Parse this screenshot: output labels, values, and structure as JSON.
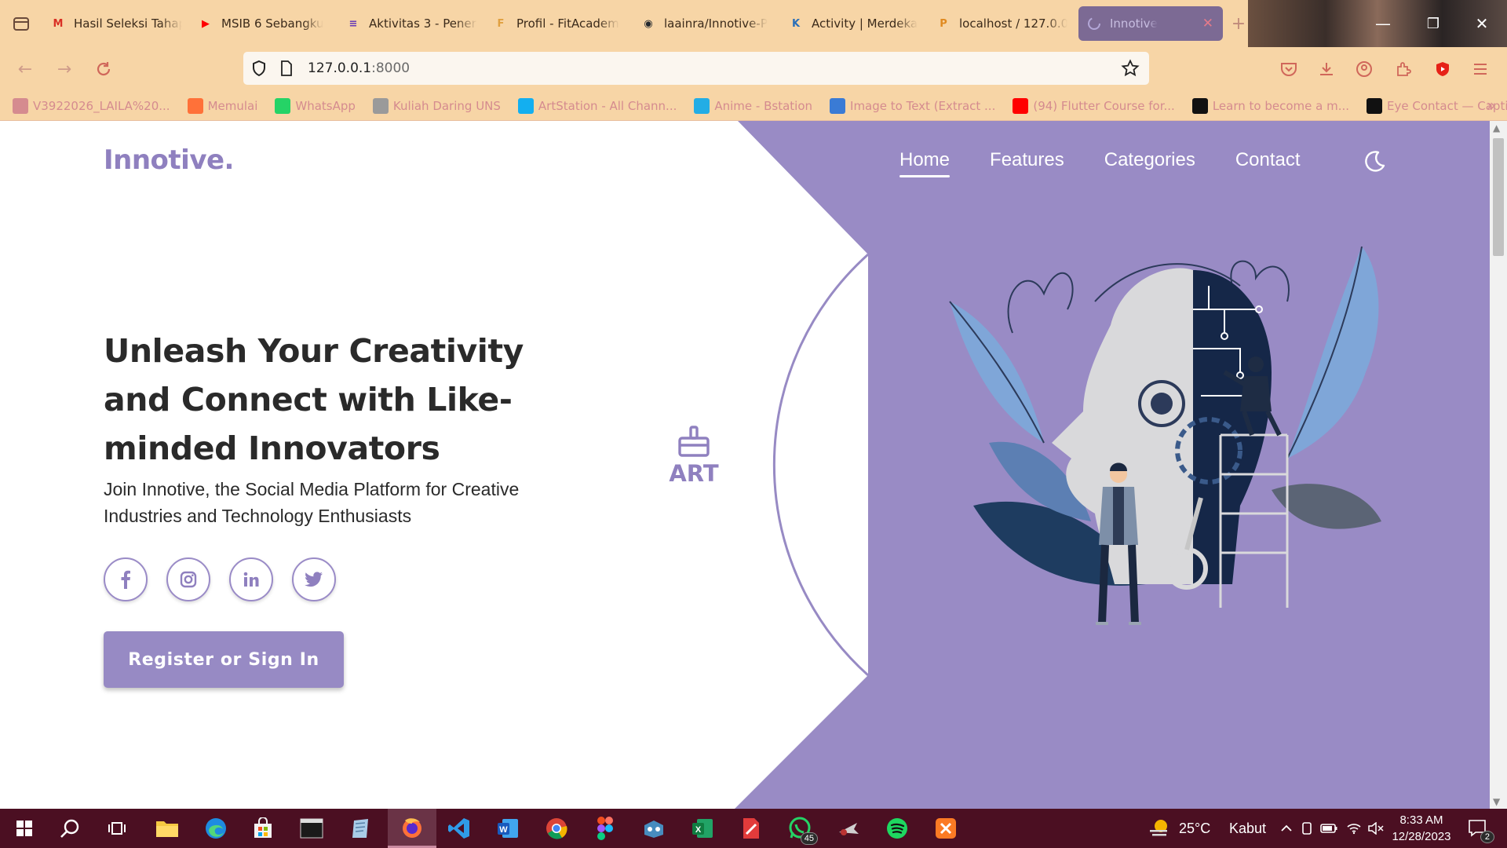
{
  "browser": {
    "tabs": [
      {
        "label": "Hasil Seleksi Tahap",
        "icon": "gmail-icon",
        "icon_text": "M",
        "icon_color": "#d93025"
      },
      {
        "label": "MSIB 6 Sebangku",
        "icon": "youtube-icon",
        "icon_text": "▶",
        "icon_color": "#ff0000"
      },
      {
        "label": "Aktivitas 3 - Penera",
        "icon": "forms-icon",
        "icon_text": "≡",
        "icon_color": "#673ab7"
      },
      {
        "label": "Profil - FitAcadem",
        "icon": "fitacademy-icon",
        "icon_text": "F",
        "icon_color": "#e0a040"
      },
      {
        "label": "laainra/Innotive-P",
        "icon": "github-icon",
        "icon_text": "◉",
        "icon_color": "#24292e"
      },
      {
        "label": "Activity | Merdeka",
        "icon": "kampus-merdeka-icon",
        "icon_text": "K",
        "icon_color": "#2a6fb8"
      },
      {
        "label": "localhost / 127.0.0",
        "icon": "phpmyadmin-icon",
        "icon_text": "P",
        "icon_color": "#e08a20"
      }
    ],
    "active_tab": {
      "label": "Innotive",
      "icon": "loading-spinner-icon"
    },
    "url_host": "127.0.0.1",
    "url_port": ":8000",
    "bookmarks": [
      {
        "label": "V3922026_LAILA%20...",
        "icon": "globe-icon",
        "color": "#d58b8f"
      },
      {
        "label": "Memulai",
        "icon": "firefox-icon",
        "color": "#ff7139"
      },
      {
        "label": "WhatsApp",
        "icon": "whatsapp-icon",
        "color": "#25d366"
      },
      {
        "label": "Kuliah Daring UNS",
        "icon": "uns-icon",
        "color": "#9a9a9a"
      },
      {
        "label": "ArtStation - All Chann...",
        "icon": "artstation-icon",
        "color": "#13aff0"
      },
      {
        "label": "Anime - Bstation",
        "icon": "bstation-icon",
        "color": "#23ade5"
      },
      {
        "label": "Image to Text (Extract ...",
        "icon": "image-to-text-icon",
        "color": "#3a7bd5"
      },
      {
        "label": "(94) Flutter Course for...",
        "icon": "youtube-icon",
        "color": "#ff0000"
      },
      {
        "label": "Learn to become a m...",
        "icon": "roadmap-icon",
        "color": "#111111"
      },
      {
        "label": "Eye Contact — Captio...",
        "icon": "captions-icon",
        "color": "#111111"
      }
    ]
  },
  "site": {
    "logo": "Innotive.",
    "nav": [
      {
        "label": "Home",
        "active": true
      },
      {
        "label": "Features",
        "active": false
      },
      {
        "label": "Categories",
        "active": false
      },
      {
        "label": "Contact",
        "active": false
      }
    ],
    "headline": "Unleash Your Creativity and Connect with Like-minded Innovators",
    "subheadline": "Join Innotive, the Social Media Platform for Creative Industries and Technology Enthusiasts",
    "socials": [
      "facebook",
      "instagram",
      "linkedin",
      "twitter"
    ],
    "cta": "Register or Sign In",
    "category_badge": "ART",
    "colors": {
      "accent": "#978ac4",
      "accent_dark": "#8f80bf",
      "text": "#2a2a2a"
    }
  },
  "taskbar": {
    "weather_temp": "25°C",
    "weather_desc": "Kabut",
    "time": "8:33 AM",
    "date": "12/28/2023",
    "whatsapp_badge": "45",
    "notification_count": "2"
  }
}
